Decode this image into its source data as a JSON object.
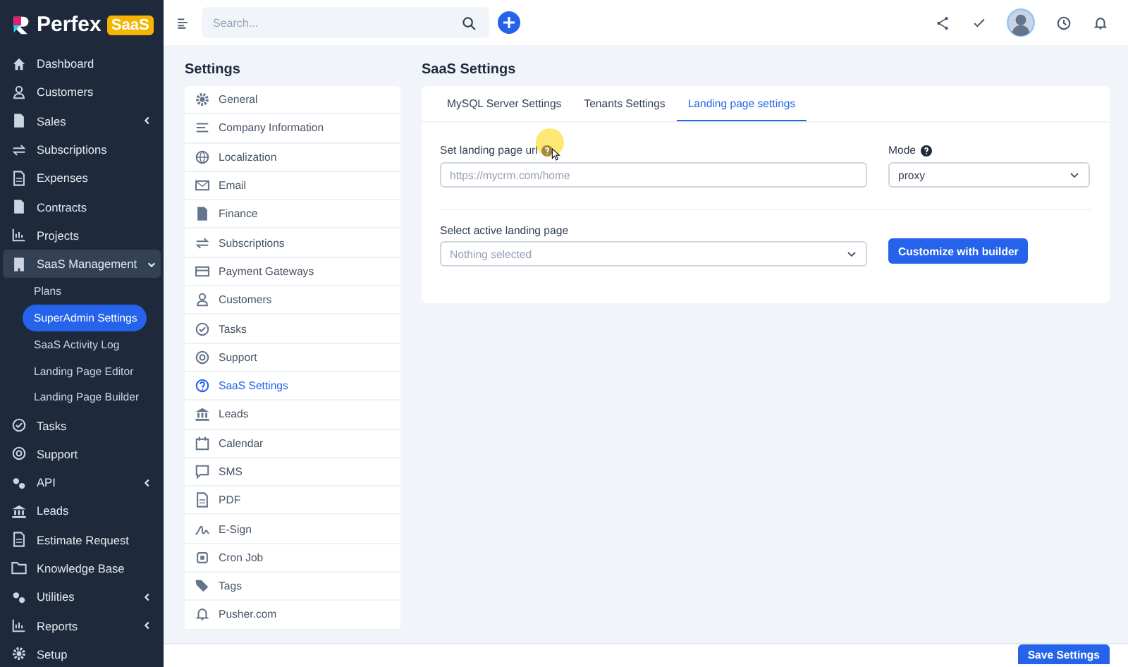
{
  "brand": {
    "name": "Perfex",
    "badge": "SaaS"
  },
  "search": {
    "placeholder": "Search..."
  },
  "sidebar": {
    "items": [
      {
        "label": "Dashboard",
        "kind": "link"
      },
      {
        "label": "Customers",
        "kind": "link"
      },
      {
        "label": "Sales",
        "kind": "group",
        "expanded": false
      },
      {
        "label": "Subscriptions",
        "kind": "link"
      },
      {
        "label": "Expenses",
        "kind": "link"
      },
      {
        "label": "Contracts",
        "kind": "link"
      },
      {
        "label": "Projects",
        "kind": "link"
      },
      {
        "label": "SaaS Management",
        "kind": "group",
        "expanded": true,
        "children": [
          {
            "label": "Plans",
            "selected": false
          },
          {
            "label": "SuperAdmin Settings",
            "selected": true
          },
          {
            "label": "SaaS Activity Log",
            "selected": false
          },
          {
            "label": "Landing Page Editor",
            "selected": false
          },
          {
            "label": "Landing Page Builder",
            "selected": false
          }
        ]
      },
      {
        "label": "Tasks",
        "kind": "link"
      },
      {
        "label": "Support",
        "kind": "link"
      },
      {
        "label": "API",
        "kind": "group",
        "expanded": false
      },
      {
        "label": "Leads",
        "kind": "link"
      },
      {
        "label": "Estimate Request",
        "kind": "link"
      },
      {
        "label": "Knowledge Base",
        "kind": "link"
      },
      {
        "label": "Utilities",
        "kind": "group",
        "expanded": false
      },
      {
        "label": "Reports",
        "kind": "group",
        "expanded": false
      },
      {
        "label": "Setup",
        "kind": "link"
      }
    ]
  },
  "settings": {
    "title": "Settings",
    "items": [
      {
        "label": "General",
        "selected": false
      },
      {
        "label": "Company Information",
        "selected": false
      },
      {
        "label": "Localization",
        "selected": false
      },
      {
        "label": "Email",
        "selected": false
      },
      {
        "label": "Finance",
        "selected": false
      },
      {
        "label": "Subscriptions",
        "selected": false
      },
      {
        "label": "Payment Gateways",
        "selected": false
      },
      {
        "label": "Customers",
        "selected": false
      },
      {
        "label": "Tasks",
        "selected": false
      },
      {
        "label": "Support",
        "selected": false
      },
      {
        "label": "SaaS Settings",
        "selected": true
      },
      {
        "label": "Leads",
        "selected": false
      },
      {
        "label": "Calendar",
        "selected": false
      },
      {
        "label": "SMS",
        "selected": false
      },
      {
        "label": "PDF",
        "selected": false
      },
      {
        "label": "E-Sign",
        "selected": false
      },
      {
        "label": "Cron Job",
        "selected": false
      },
      {
        "label": "Tags",
        "selected": false
      },
      {
        "label": "Pusher.com",
        "selected": false
      }
    ]
  },
  "panel": {
    "title": "SaaS Settings",
    "tabs": [
      {
        "label": "MySQL Server Settings",
        "selected": false
      },
      {
        "label": "Tenants Settings",
        "selected": false
      },
      {
        "label": "Landing page settings",
        "selected": true
      }
    ],
    "url_field": {
      "label": "Set landing page url",
      "placeholder": "https://mycrm.com/home"
    },
    "mode": {
      "label": "Mode",
      "value": "proxy"
    },
    "landing_select": {
      "label": "Select active landing page",
      "placeholder": "Nothing selected"
    },
    "builder_button": "Customize with builder"
  },
  "save_button": "Save Settings"
}
